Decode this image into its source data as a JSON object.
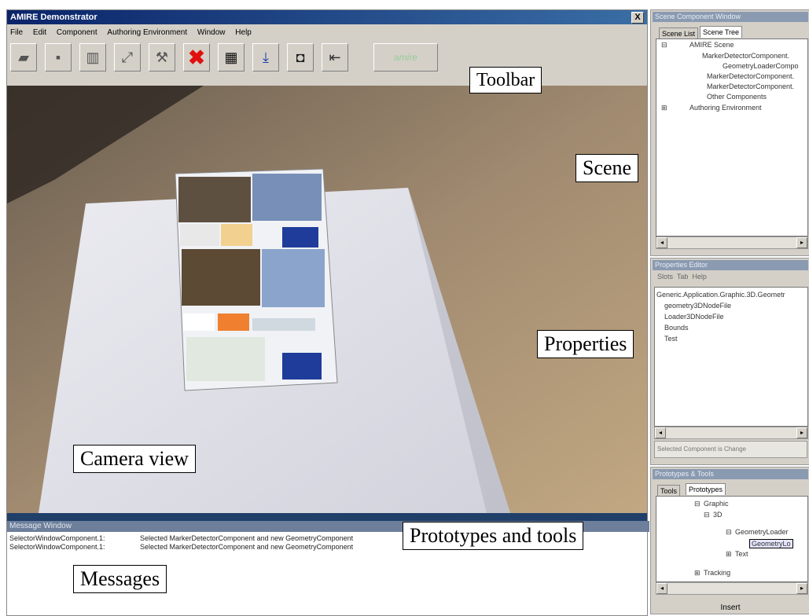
{
  "window": {
    "title": "AMIRE Demonstrator",
    "close_glyph": "X"
  },
  "menu": [
    "File",
    "Edit",
    "Component",
    "Authoring Environment",
    "Window",
    "Help"
  ],
  "toolbar": {
    "buttons": [
      {
        "icon": "open-folder-icon",
        "glyph": "▰"
      },
      {
        "icon": "save-icon",
        "glyph": "▪"
      },
      {
        "icon": "library-icon",
        "glyph": "▥"
      },
      {
        "icon": "link-icon",
        "glyph": "⤢"
      },
      {
        "icon": "tools-icon",
        "glyph": "⚒"
      },
      {
        "icon": "delete-icon",
        "glyph": "✖"
      },
      {
        "icon": "marker-icon",
        "glyph": "▦"
      },
      {
        "icon": "import-icon",
        "glyph": "⤓"
      },
      {
        "icon": "window-icon",
        "glyph": "◘"
      },
      {
        "icon": "exit-icon",
        "glyph": "⇤"
      }
    ],
    "logo_text": "amire"
  },
  "camera": {
    "status": ""
  },
  "messages": {
    "title": "Message Window",
    "rows": [
      {
        "source": "SelectorWindowComponent.1:",
        "text": "Selected MarkerDetectorComponent and new GeometryComponent"
      },
      {
        "source": "SelectorWindowComponent.1:",
        "text": "Selected MarkerDetectorComponent and new GeometryComponent"
      }
    ]
  },
  "scene_panel": {
    "title": "Scene Component Window",
    "tabs": [
      "Scene List",
      "Scene Tree"
    ],
    "items": [
      "AMIRE Scene",
      "MarkerDetectorComponent.",
      "GeometryLoaderCompo",
      "MarkerDetectorComponent.",
      "MarkerDetectorComponent.",
      "Other Components",
      "Authoring Environment"
    ]
  },
  "properties_panel": {
    "title": "Properties Editor",
    "menu": [
      "Slots",
      "Tab",
      "Help"
    ],
    "items": [
      "Generic.Application.Graphic.3D.Geometr",
      "geometry3DNodeFile",
      "Loader3DNodeFile",
      "Bounds",
      "Test"
    ],
    "footer": "Selected Component is Change"
  },
  "prototypes_panel": {
    "title": "Prototypes & Tools",
    "tabs": [
      "Tools",
      "Prototypes"
    ],
    "items": [
      "Graphic",
      "3D",
      "GeometryLoader",
      "GeometryLo",
      "Text",
      "Tracking"
    ],
    "insert": "Insert"
  },
  "labels": {
    "toolbar": "Toolbar",
    "scene": "Scene",
    "properties": "Properties",
    "camera": "Camera view",
    "prototypes": "Prototypes and tools",
    "messages": "Messages"
  }
}
